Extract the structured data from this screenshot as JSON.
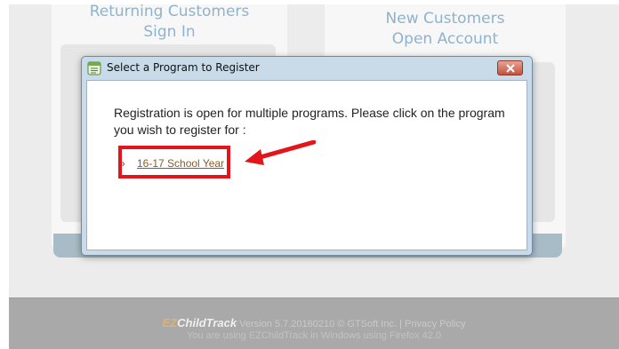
{
  "page": {
    "returning": {
      "title_line1": "Returning Customers",
      "title_line2": "Sign In"
    },
    "new": {
      "title_line1": "New Customers",
      "title_line2": "Open Account"
    }
  },
  "footer": {
    "brand_ez": "EZ",
    "brand_ct": "ChildTrack",
    "version_text": "Version 5.7.20160210 © GTSoft Inc. | Privacy Policy",
    "env_text": "You are using EZChildTrack in Windows using Firefox 42.0"
  },
  "dialog": {
    "title": "Select a Program to Register",
    "message": "Registration is open for multiple programs. Please click on the program you wish to register for :",
    "programs": [
      {
        "label": "16-17 School Year"
      }
    ]
  },
  "colors": {
    "highlight": "#e3151a",
    "link": "#8a5a28",
    "accent_blue": "#8fb3cc"
  },
  "icons": {
    "title": "dialog-window-icon",
    "close": "close-icon",
    "bullet": "bullet-icon",
    "annotation_arrow": "arrow-icon"
  }
}
